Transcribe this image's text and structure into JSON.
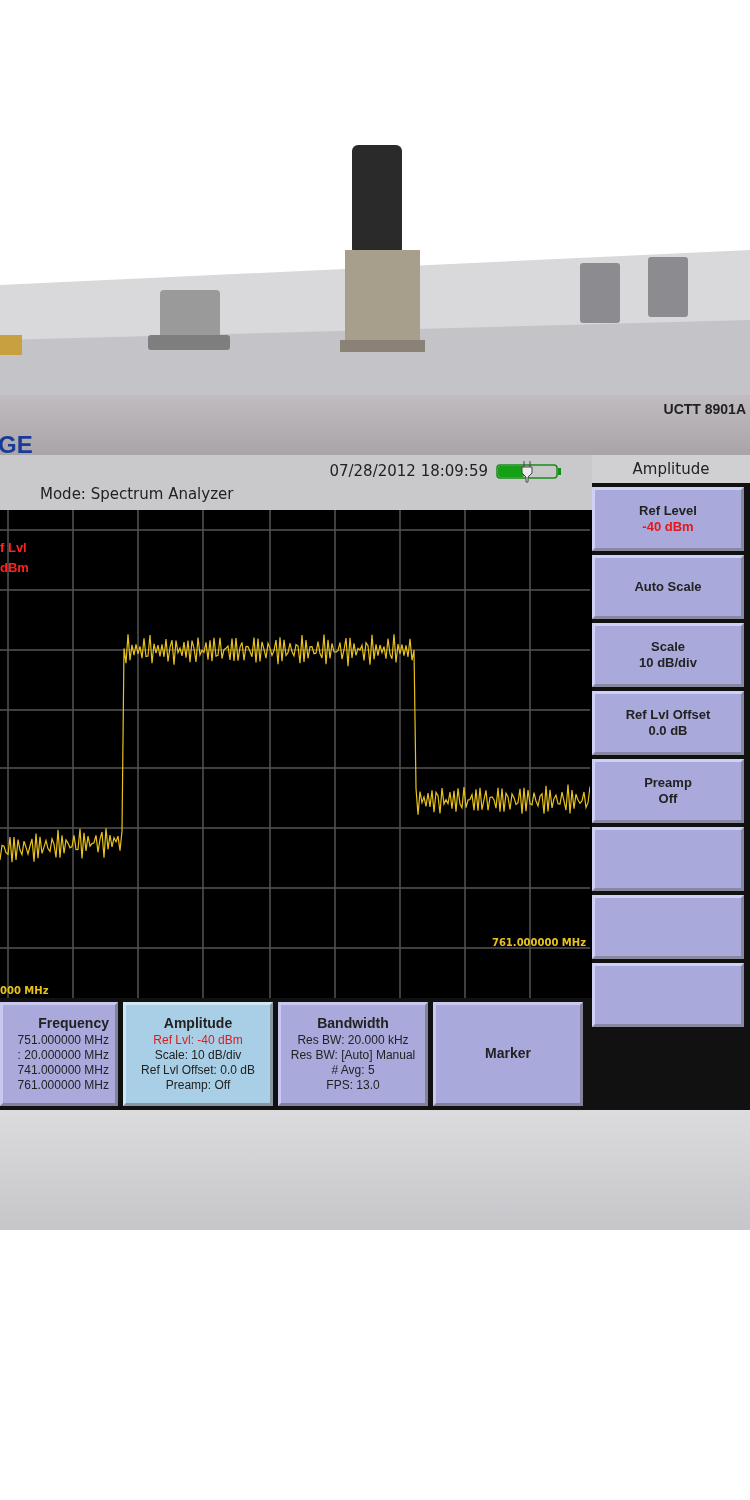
{
  "device": {
    "logo": "GE",
    "model": "UCTT 8901A"
  },
  "status_bar": {
    "mode": "Mode: Spectrum Analyzer",
    "datetime": "07/28/2012 18:09:59",
    "battery": {
      "level": 0.45
    }
  },
  "plot": {
    "ref_label": "f Lvl",
    "ref_value": "dBm",
    "start_freq": "000 MHz",
    "stop_freq": "761.000000 MHz"
  },
  "menu": {
    "title": "Amplitude",
    "softkeys": [
      {
        "kind": "labeled",
        "lines": [
          {
            "text": "Ref Level",
            "alert": false
          },
          {
            "text": "-40 dBm",
            "alert": true
          }
        ]
      },
      {
        "kind": "labeled",
        "lines": [
          {
            "text": "Auto Scale",
            "alert": false
          }
        ]
      },
      {
        "kind": "labeled",
        "lines": [
          {
            "text": "Scale",
            "alert": false
          },
          {
            "text": "10 dB/div",
            "alert": false
          }
        ]
      },
      {
        "kind": "labeled",
        "lines": [
          {
            "text": "Ref Lvl Offset",
            "alert": false
          },
          {
            "text": "0.0 dB",
            "alert": false
          }
        ]
      },
      {
        "kind": "labeled",
        "lines": [
          {
            "text": "Preamp",
            "alert": false
          },
          {
            "text": "Off",
            "alert": false
          }
        ]
      },
      {
        "kind": "blank"
      },
      {
        "kind": "blank"
      },
      {
        "kind": "blank"
      }
    ]
  },
  "function_buttons": [
    {
      "title": "Frequency",
      "selected": false,
      "lines": [
        {
          "text": "751.000000 MHz",
          "alert": false
        },
        {
          "text": ": 20.000000 MHz",
          "alert": false
        },
        {
          "text": "741.000000 MHz",
          "alert": false
        },
        {
          "text": "761.000000 MHz",
          "alert": false
        }
      ]
    },
    {
      "title": "Amplitude",
      "selected": true,
      "lines": [
        {
          "text": "Ref Lvl:  -40 dBm",
          "alert": true
        },
        {
          "text": "Scale:  10 dB/div",
          "alert": false
        },
        {
          "text": "Ref Lvl Offset:  0.0 dB",
          "alert": false
        },
        {
          "text": "Preamp:  Off",
          "alert": false
        }
      ]
    },
    {
      "title": "Bandwidth",
      "selected": false,
      "lines": [
        {
          "text": "Res BW:  20.000 kHz",
          "alert": false
        },
        {
          "text": "Res BW:  [Auto] Manual",
          "alert": false
        },
        {
          "text": "# Avg:  5",
          "alert": false
        },
        {
          "text": "FPS:  13.0",
          "alert": false
        }
      ]
    },
    {
      "title": "Marker",
      "selected": false
    }
  ]
}
